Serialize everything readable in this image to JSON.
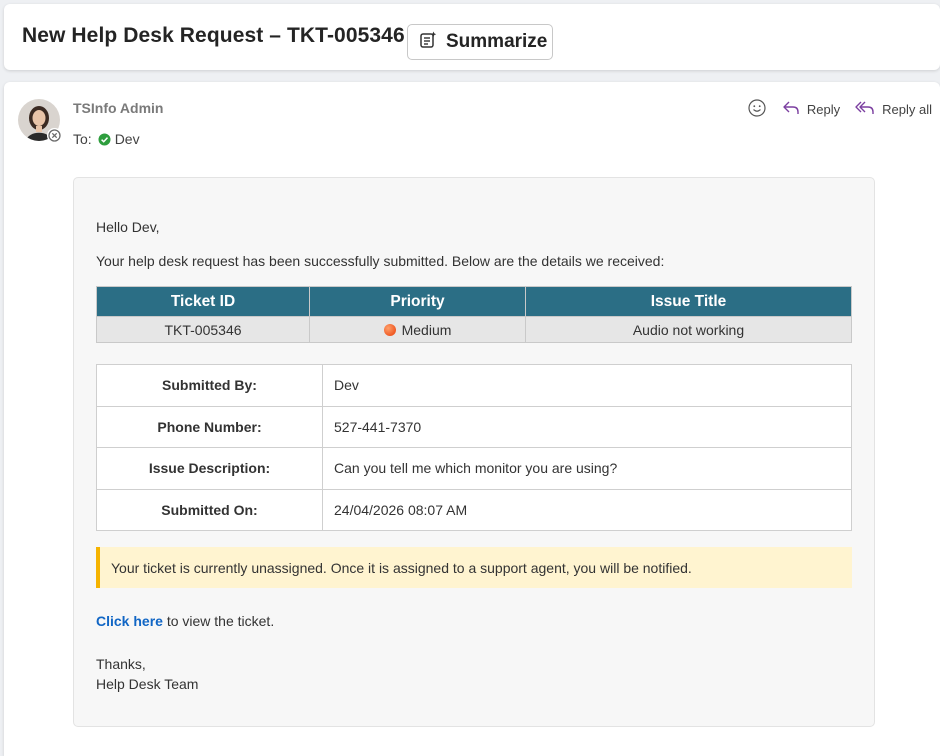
{
  "header": {
    "subject": "New Help Desk Request – TKT-005346",
    "summarize_label": "Summarize"
  },
  "message": {
    "sender_name": "TSInfo Admin",
    "to_label": "To:",
    "recipient": "Dev",
    "actions": {
      "react_icon": "smiley-icon",
      "reply_label": "Reply",
      "reply_all_label": "Reply all"
    }
  },
  "body": {
    "greeting": "Hello Dev,",
    "intro": "Your help desk request has been successfully submitted. Below are the details we received:",
    "ticket_table": {
      "headers": [
        "Ticket ID",
        "Priority",
        "Issue Title"
      ],
      "row": {
        "ticket_id": "TKT-005346",
        "priority": "Medium",
        "priority_color": "#ef5a24",
        "issue_title": "Audio not working"
      },
      "header_color": "#2b6e85"
    },
    "details": [
      {
        "label": "Submitted By:",
        "value": "Dev"
      },
      {
        "label": "Phone Number:",
        "value": "527-441-7370"
      },
      {
        "label": "Issue Description:",
        "value": "Can you tell me which monitor you are using?"
      },
      {
        "label": "Submitted On:",
        "value": "24/04/2026 08:07 AM"
      }
    ],
    "notice": "Your ticket is currently unassigned. Once it is assigned to a support agent, you will be notified.",
    "link_text": "Click here",
    "link_suffix": " to view the ticket.",
    "thanks": "Thanks,",
    "team": "Help Desk Team"
  },
  "colors": {
    "accent_link": "#1166c5",
    "reply_icon": "#7b3fa0",
    "notice_bar": "#f5b300",
    "notice_bg": "#fff4d0",
    "status_ok": "#2e9e3e"
  }
}
